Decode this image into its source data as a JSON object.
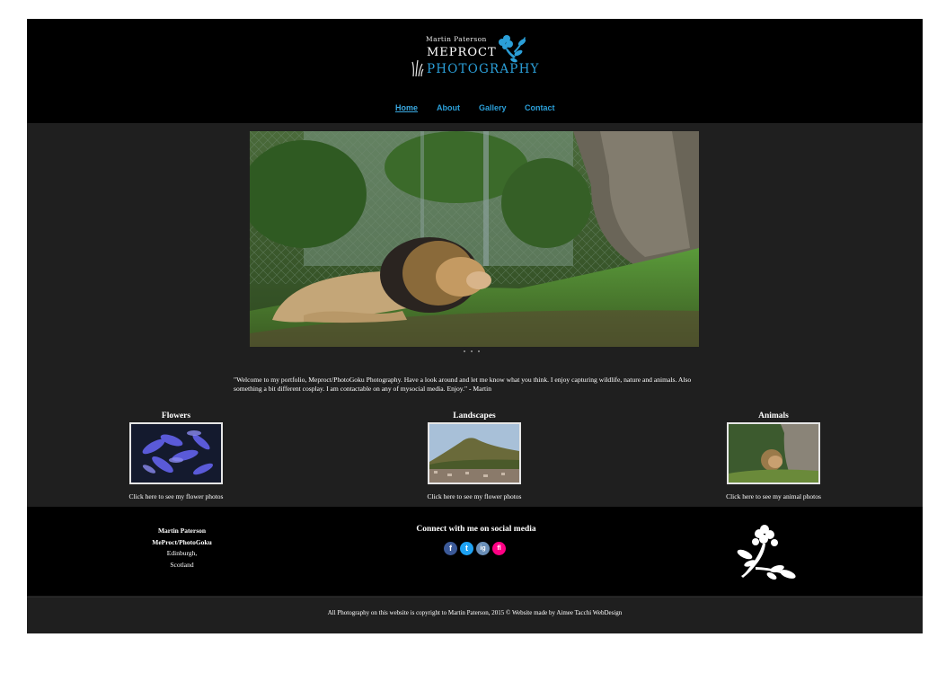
{
  "logo": {
    "small": "Martin Paterson",
    "line1": "MEPROCT",
    "line2": "PHOTOGRAPHY"
  },
  "nav": {
    "home": "Home",
    "about": "About",
    "gallery": "Gallery",
    "contact": "Contact"
  },
  "colors": {
    "accent": "#2b9fd8",
    "header_bg": "#000000",
    "body_bg": "#1f1f1f"
  },
  "welcome": "\"Welcome to my portfolio, Meproct/PhotoGoku Photography. Have a look around and let me know what you think. I enjoy capturing wildlife, nature and animals. Also something a bit different cosplay. I am contactable on any of mysocial media. Enjoy.\" - Martin",
  "categories": [
    {
      "title": "Flowers",
      "caption": "Click here to see my flower photos"
    },
    {
      "title": "Landscapes",
      "caption": "Click here to see my flower photos"
    },
    {
      "title": "Animals",
      "caption": "Click here to see my animal photos"
    }
  ],
  "footer": {
    "name": "Martin Paterson",
    "brand": "MeProct/PhotoGoku",
    "city": "Edinburgh,",
    "country": "Scotland",
    "social_title": "Connect with me on social media",
    "social": [
      "f",
      "t",
      "ig",
      "fl"
    ],
    "copyright": "All Photography on this website is copyright to Martin Paterson, 2015 © Website made by Aimee Tacchi WebDesign"
  }
}
